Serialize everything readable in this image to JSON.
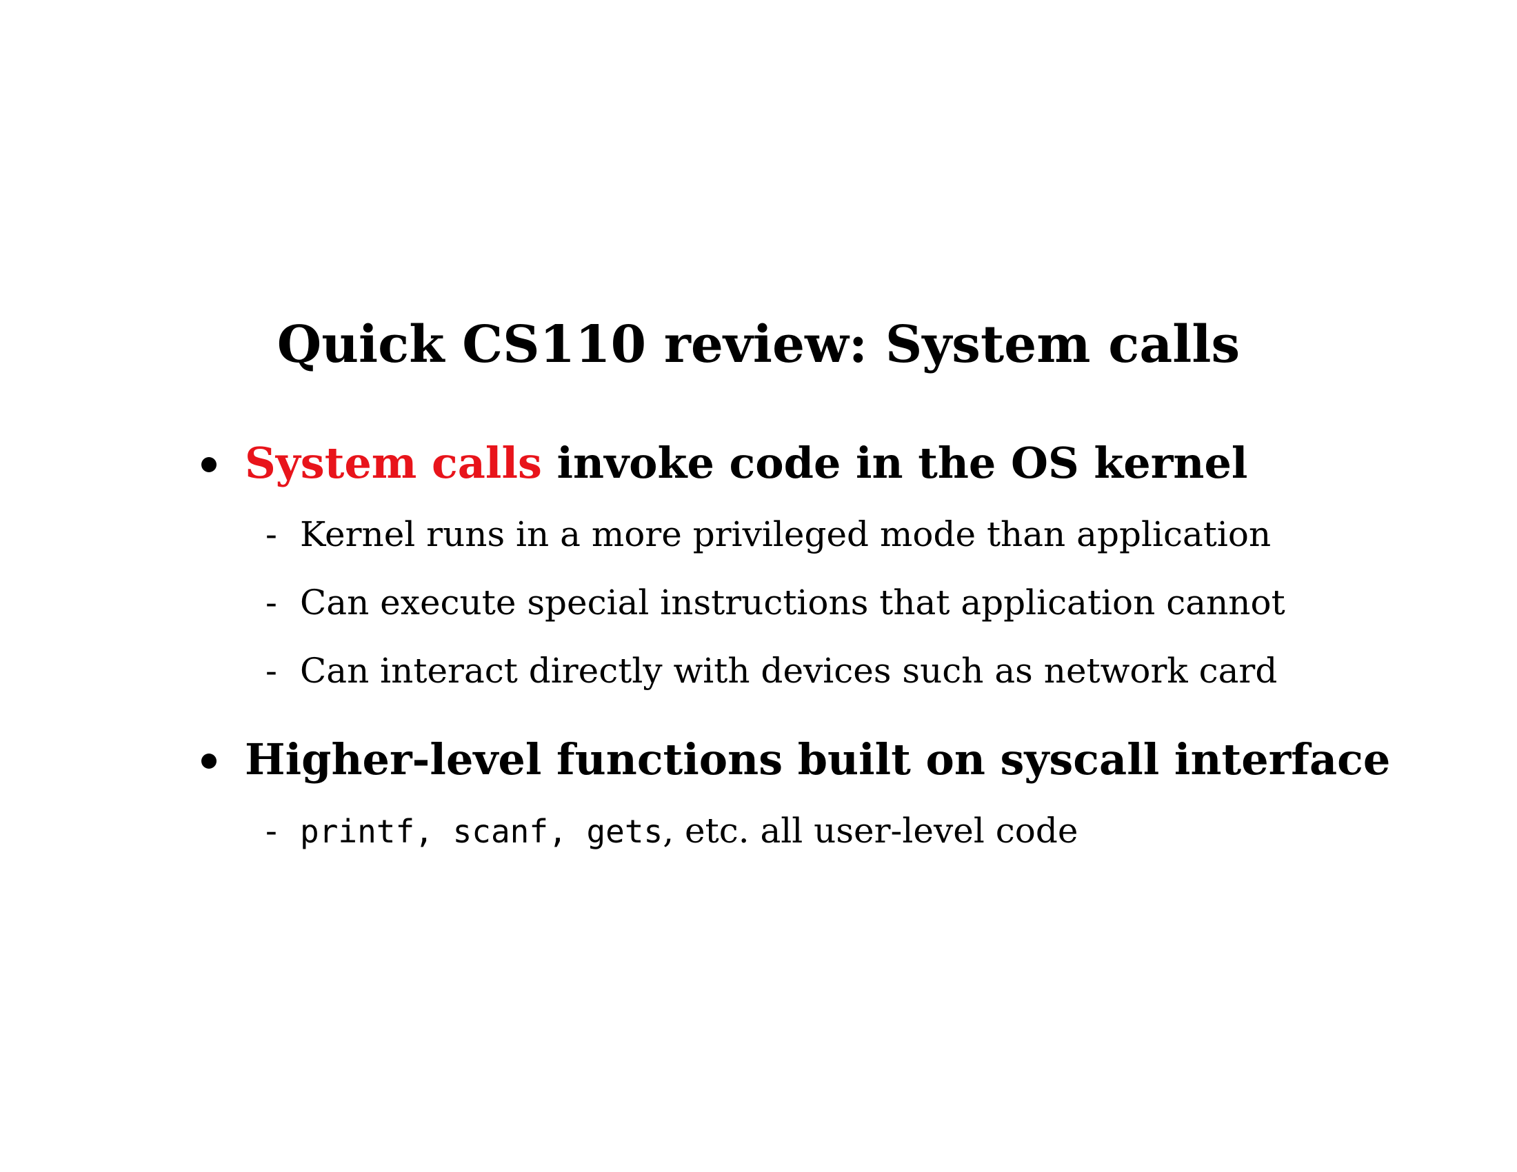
{
  "slide": {
    "title": "Quick CS110 review: System calls",
    "bullets": [
      {
        "highlight": "System calls",
        "text": " invoke code in the OS kernel",
        "highlight_color": "#e8141b",
        "subitems": [
          {
            "dash": "-",
            "text": "Kernel runs in a more privileged mode than application"
          },
          {
            "dash": "-",
            "text": "Can execute special instructions that application cannot"
          },
          {
            "dash": "-",
            "text": "Can interact directly with devices such as network card"
          }
        ]
      },
      {
        "text": "Higher-level functions built on syscall interface",
        "subitems": [
          {
            "dash": "-",
            "code1": "printf",
            "sep1": ", ",
            "code2": "scanf",
            "sep2": ", ",
            "code3": "gets",
            "rest": ", etc. all user-level code"
          }
        ]
      }
    ]
  }
}
